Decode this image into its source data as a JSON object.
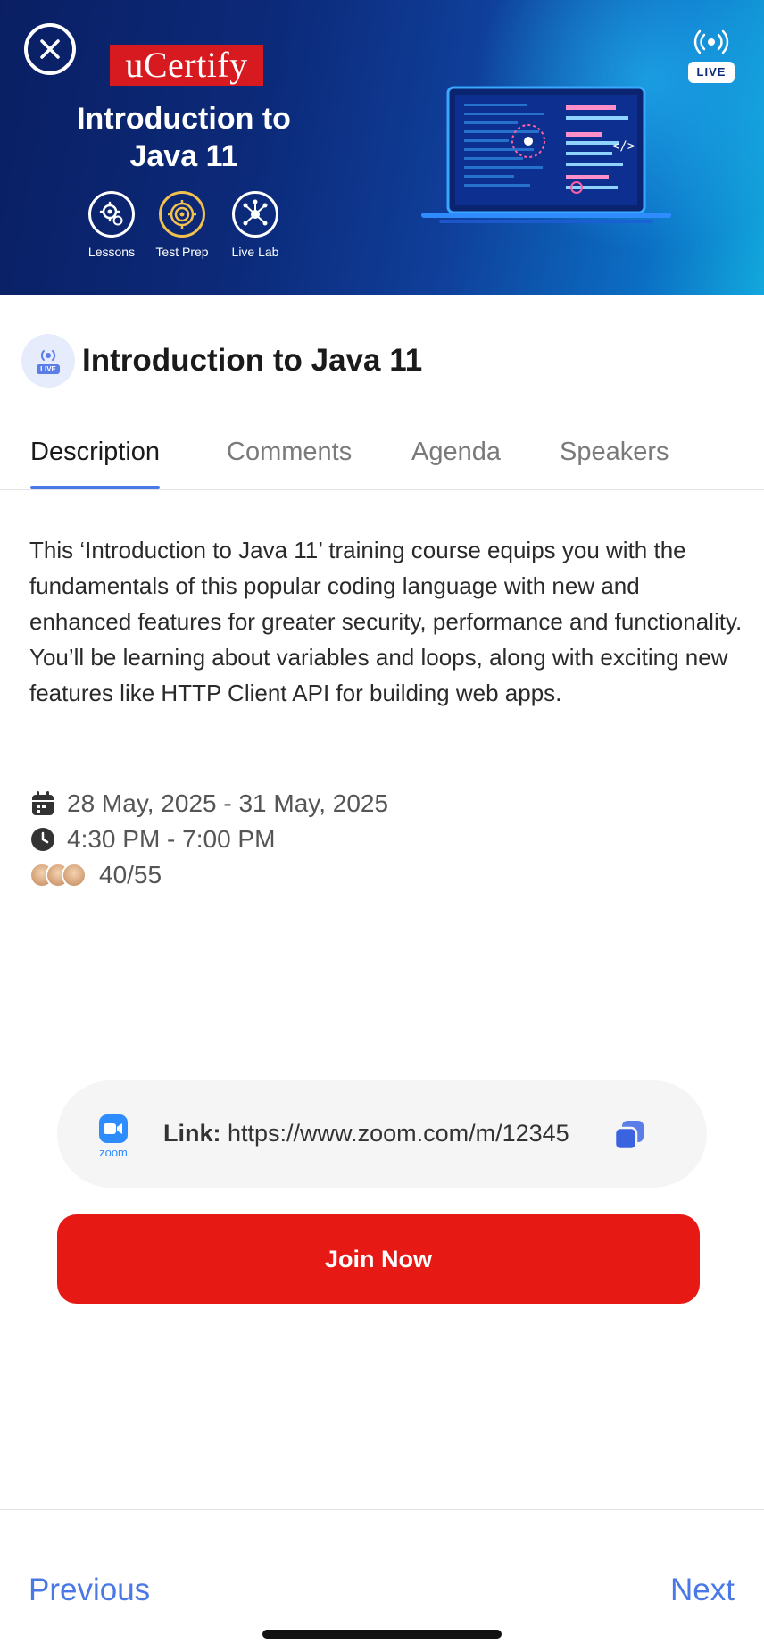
{
  "banner": {
    "brand": "uCertify",
    "title_line1": "Introduction to",
    "title_line2": "Java 11",
    "features": [
      {
        "label": "Lessons",
        "icon": "gears-icon"
      },
      {
        "label": "Test Prep",
        "icon": "target-icon"
      },
      {
        "label": "Live Lab",
        "icon": "network-icon"
      }
    ],
    "live_badge": "LIVE",
    "close_icon": "close-icon"
  },
  "header": {
    "avatar_tag": "LIVE",
    "title": "Introduction to Java 11"
  },
  "tabs": [
    {
      "label": "Description",
      "active": true
    },
    {
      "label": "Comments",
      "active": false
    },
    {
      "label": "Agenda",
      "active": false
    },
    {
      "label": "Speakers",
      "active": false
    }
  ],
  "description": "This ‘Introduction to Java 11’ training course equips you with the fundamentals of this popular coding language with new and enhanced features for greater security, performance and functionality. You’ll be learning about variables and loops, along with exciting new features like HTTP Client API for building web apps.",
  "meta": {
    "dates": "28 May, 2025 - 31 May, 2025",
    "time": "4:30 PM - 7:00 PM",
    "attendees": "40/55"
  },
  "link": {
    "provider": "zoom",
    "label": "Link:",
    "url": "https://www.zoom.com/m/12345"
  },
  "join_button": "Join Now",
  "footer": {
    "previous": "Previous",
    "next": "Next"
  },
  "colors": {
    "accent": "#4a78e6",
    "join": "#e61914",
    "brand_red": "#d71a20",
    "zoom_blue": "#2d8cff"
  }
}
